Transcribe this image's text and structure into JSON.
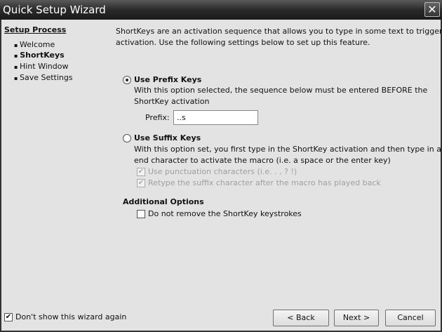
{
  "title": "Quick Setup Wizard",
  "sidebar": {
    "heading": "Setup Process",
    "items": [
      {
        "label": "Welcome"
      },
      {
        "label": "ShortKeys"
      },
      {
        "label": "Hint Window"
      },
      {
        "label": "Save Settings"
      }
    ]
  },
  "intro": [
    "ShortKeys are an activation sequence that allows you to type in some text to trigger the",
    "activation.  Use the following settings below to set up this feature."
  ],
  "prefix": {
    "label": "Use Prefix Keys",
    "desc": [
      "With this option selected, the sequence below must be entered BEFORE the",
      "ShortKey activation"
    ],
    "field_label": "Prefix:",
    "value": "..s",
    "selected": true
  },
  "suffix": {
    "label": "Use Suffix Keys",
    "desc": [
      "With this option set, you first type in the ShortKey activation and then type in an",
      "end character to activate the macro (i.e. a space or the enter key)"
    ],
    "opt1": "Use punctuation characters (i.e. . , ? !)",
    "opt2": "Retype the suffix character after the macro has played back",
    "selected": false
  },
  "additional": {
    "heading": "Additional Options",
    "opt": "Do not remove the ShortKey keystrokes"
  },
  "footer": {
    "dont_show": "Don't show this wizard again",
    "back": "< Back",
    "next": "Next >",
    "cancel": "Cancel"
  }
}
